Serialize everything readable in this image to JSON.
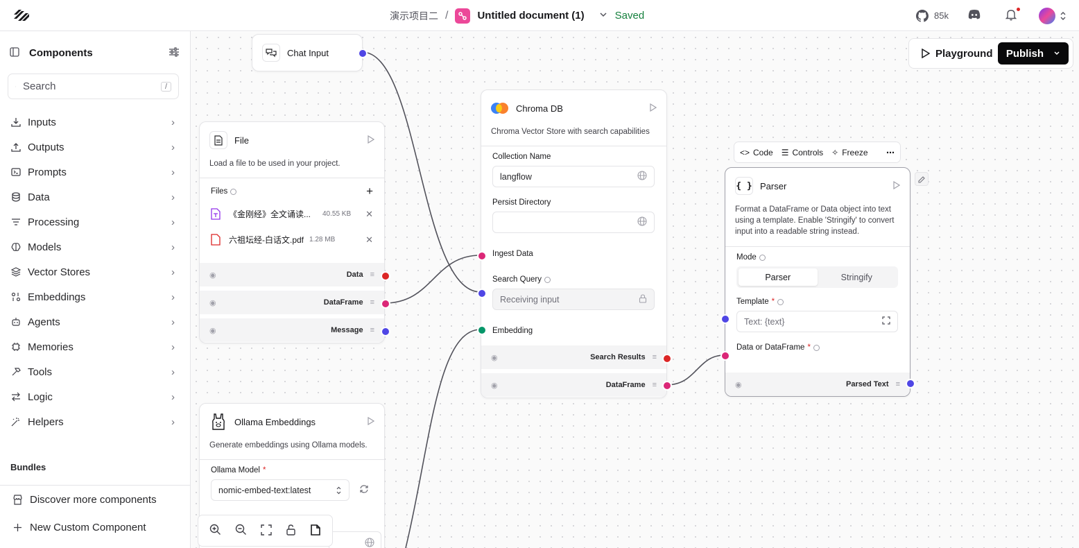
{
  "header": {
    "project_name": "演示项目二",
    "separator": "/",
    "document_title": "Untitled document (1)",
    "save_status": "Saved",
    "github_stars": "85k",
    "icons": [
      "langflow-logo-icon",
      "flow-icon",
      "chevron-down-icon",
      "github-icon",
      "discord-icon",
      "bell-icon",
      "avatar"
    ]
  },
  "sidebar": {
    "title": "Components",
    "search_placeholder": "Search",
    "search_shortcut": "/",
    "categories": [
      {
        "label": "Inputs",
        "icon": "download-icon"
      },
      {
        "label": "Outputs",
        "icon": "upload-icon"
      },
      {
        "label": "Prompts",
        "icon": "terminal-icon"
      },
      {
        "label": "Data",
        "icon": "database-icon"
      },
      {
        "label": "Processing",
        "icon": "list-filter-icon"
      },
      {
        "label": "Models",
        "icon": "brain-icon"
      },
      {
        "label": "Vector Stores",
        "icon": "layers-icon"
      },
      {
        "label": "Embeddings",
        "icon": "binary-icon"
      },
      {
        "label": "Agents",
        "icon": "bot-icon"
      },
      {
        "label": "Memories",
        "icon": "cpu-icon"
      },
      {
        "label": "Tools",
        "icon": "hammer-icon"
      },
      {
        "label": "Logic",
        "icon": "arrows-icon"
      },
      {
        "label": "Helpers",
        "icon": "wand-icon"
      }
    ],
    "bundles_label": "Bundles",
    "discover_label": "Discover more components",
    "custom_label": "New Custom Component"
  },
  "toolbar": {
    "playground_label": "Playground",
    "publish_label": "Publish"
  },
  "nodes": {
    "chat_input": {
      "title": "Chat Input"
    },
    "file": {
      "title": "File",
      "description": "Load a file to be used in your project.",
      "files_label": "Files",
      "files": [
        {
          "name": "《金刚经》全文诵读...",
          "size": "40.55 KB",
          "type": "text"
        },
        {
          "name": "六祖坛经-白话文.pdf",
          "size": "1.28 MB",
          "type": "pdf"
        }
      ],
      "outputs": [
        "Data",
        "DataFrame",
        "Message"
      ]
    },
    "chroma": {
      "title": "Chroma DB",
      "description": "Chroma Vector Store with search capabilities",
      "collection_label": "Collection Name",
      "collection_value": "langflow",
      "persist_label": "Persist Directory",
      "persist_value": "",
      "ingest_label": "Ingest Data",
      "search_label": "Search Query",
      "search_placeholder": "Receiving input",
      "embedding_label": "Embedding",
      "outputs": [
        "Search Results",
        "DataFrame"
      ]
    },
    "parser": {
      "title": "Parser",
      "description": "Format a DataFrame or Data object into text using a template. Enable 'Stringify' to convert input into a readable string instead.",
      "mode_label": "Mode",
      "mode_options": [
        "Parser",
        "Stringify"
      ],
      "template_label": "Template",
      "template_placeholder": "Text: {text}",
      "data_label": "Data or DataFrame",
      "output": "Parsed Text"
    },
    "ollama": {
      "title": "Ollama Embeddings",
      "description": "Generate embeddings using Ollama models.",
      "model_label": "Ollama Model",
      "model_value": "nomic-embed-text:latest"
    }
  },
  "node_toolbar": {
    "code_label": "Code",
    "controls_label": "Controls",
    "freeze_label": "Freeze"
  },
  "colors": {
    "blue_handle": "#4f46e5",
    "pink_handle": "#db2777",
    "red_handle": "#dc2626",
    "green_handle": "#059669",
    "saved_green": "#15803d"
  }
}
